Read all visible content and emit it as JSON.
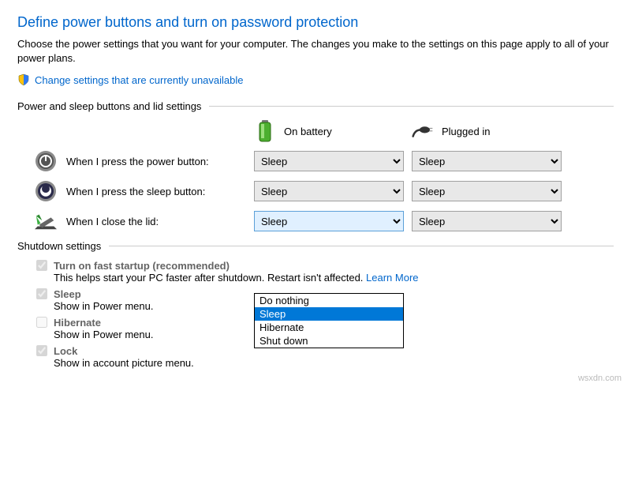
{
  "title": "Define power buttons and turn on password protection",
  "description": "Choose the power settings that you want for your computer. The changes you make to the settings on this page apply to all of your power plans.",
  "change_link": "Change settings that are currently unavailable",
  "group1_title": "Power and sleep buttons and lid settings",
  "col_battery": "On battery",
  "col_plugged": "Plugged in",
  "rows": {
    "power": {
      "label": "When I press the power button:",
      "battery": "Sleep",
      "plugged": "Sleep"
    },
    "sleep": {
      "label": "When I press the sleep button:",
      "battery": "Sleep",
      "plugged": "Sleep"
    },
    "lid": {
      "label": "When I close the lid:",
      "battery": "Sleep",
      "plugged": "Sleep"
    }
  },
  "dropdown_options": [
    "Do nothing",
    "Sleep",
    "Hibernate",
    "Shut down"
  ],
  "group2_title": "Shutdown settings",
  "shutdown": {
    "fast": {
      "label": "Turn on fast startup (recommended)",
      "sub_pre": "This helps start your PC faster after shutdown. Restart isn't affected. ",
      "learn": "Learn More"
    },
    "sleep": {
      "label": "Sleep",
      "sub": "Show in Power menu."
    },
    "hib": {
      "label": "Hibernate",
      "sub": "Show in Power menu."
    },
    "lock": {
      "label": "Lock",
      "sub": "Show in account picture menu."
    }
  },
  "watermark": "wsxdn.com"
}
